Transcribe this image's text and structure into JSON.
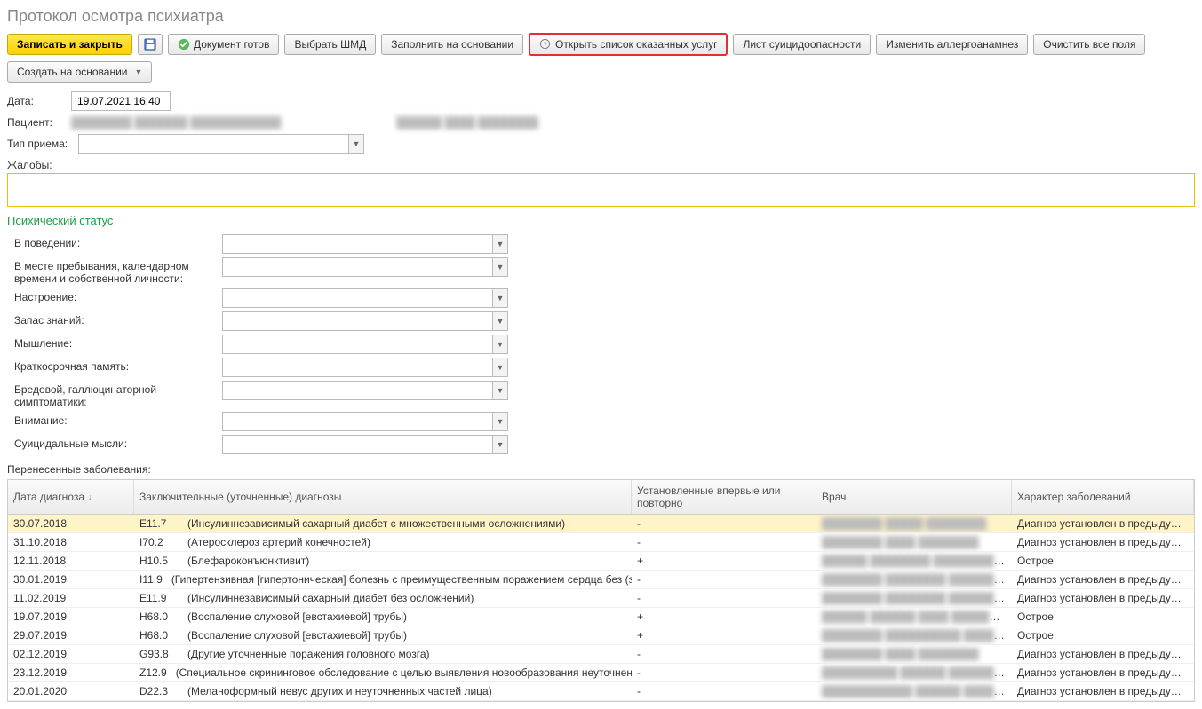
{
  "title": "Протокол осмотра психиатра",
  "toolbar": {
    "save_close": "Записать и закрыть",
    "doc_ready": "Документ готов",
    "select_shmd": "Выбрать ШМД",
    "fill_basis": "Заполнить на основании",
    "open_services": "Открыть список оказанных услуг",
    "suicide_sheet": "Лист суицидоопасности",
    "change_allergo": "Изменить аллергоанамнез",
    "clear_all": "Очистить все поля",
    "create_basis": "Создать на основании"
  },
  "form": {
    "date_label": "Дата:",
    "date_value": "19.07.2021 16:40",
    "patient_label": "Пациент:",
    "patient_value": "████████ ███████ ████████████",
    "patient_extra": "██████ ████ ████████",
    "type_label": "Тип приема:",
    "type_value": "",
    "complaints_label": "Жалобы:",
    "complaints_value": ""
  },
  "psych_status": {
    "title": "Психический статус",
    "rows": [
      {
        "label": "В поведении:",
        "value": ""
      },
      {
        "label": "В месте пребывания, календарном времени и собственной личности:",
        "value": ""
      },
      {
        "label": "Настроение:",
        "value": ""
      },
      {
        "label": "Запас знаний:",
        "value": ""
      },
      {
        "label": "Мышление:",
        "value": ""
      },
      {
        "label": "Краткосрочная память:",
        "value": ""
      },
      {
        "label": "Бредовой, галлюцинаторной симптоматики:",
        "value": ""
      },
      {
        "label": "Внимание:",
        "value": ""
      },
      {
        "label": "Суицидальные мысли:",
        "value": ""
      }
    ]
  },
  "diseases": {
    "label": "Перенесенные заболевания:",
    "columns": {
      "date": "Дата диагноза",
      "diag": "Заключительные (уточненные) диагнозы",
      "ust": "Установленные впервые или повторно",
      "doc": "Врач",
      "char": "Характер заболеваний"
    },
    "rows": [
      {
        "date": "30.07.2018",
        "code": "E11.7",
        "name": "(Инсулиннезависимый сахарный диабет с множественными осложнениями)",
        "ust": "-",
        "doc": "████████ █████ ████████",
        "char": "Диагноз установлен в предыдущем го…",
        "sel": true
      },
      {
        "date": "31.10.2018",
        "code": "I70.2",
        "name": "(Атеросклероз артерий конечностей)",
        "ust": "-",
        "doc": "████████ ████ ████████",
        "char": "Диагноз установлен в предыдущем го…"
      },
      {
        "date": "12.11.2018",
        "code": "H10.5",
        "name": "(Блефароконъюнктивит)",
        "ust": "+",
        "doc": "██████ ████████ ██████████",
        "char": "Острое"
      },
      {
        "date": "30.01.2019",
        "code": "I11.9",
        "name": "(Гипертензивная [гипертоническая] болезнь с преимущественным поражением сердца без (зас…",
        "ust": "-",
        "doc": "████████ ████████ ██████████████",
        "char": "Диагноз установлен в предыдущем го…"
      },
      {
        "date": "11.02.2019",
        "code": "E11.9",
        "name": "(Инсулиннезависимый сахарный диабет без осложнений)",
        "ust": "-",
        "doc": "████████ ████████ ██████████",
        "char": "Диагноз установлен в предыдущем го…"
      },
      {
        "date": "19.07.2019",
        "code": "H68.0",
        "name": "(Воспаление слуховой [евстахиевой] трубы)",
        "ust": "+",
        "doc": "██████ ██████ ████ ██████████",
        "char": "Острое"
      },
      {
        "date": "29.07.2019",
        "code": "H68.0",
        "name": "(Воспаление слуховой [евстахиевой] трубы)",
        "ust": "+",
        "doc": "████████ ██████████ ██████████",
        "char": "Острое"
      },
      {
        "date": "02.12.2019",
        "code": "G93.8",
        "name": "(Другие уточненные поражения головного мозга)",
        "ust": "-",
        "doc": "████████ ████ ████████",
        "char": "Диагноз установлен в предыдущем го…"
      },
      {
        "date": "23.12.2019",
        "code": "Z12.9",
        "name": "(Специальное скрининговое обследование с целью выявления новообразования неуточненного)",
        "ust": "-",
        "doc": "██████████ ██████ ██████████████",
        "char": "Диагноз установлен в предыдущем го…"
      },
      {
        "date": "20.01.2020",
        "code": "D22.3",
        "name": "(Меланоформный невус других и неуточненных частей лица)",
        "ust": "-",
        "doc": "████████████ ██████ ██████████",
        "char": "Диагноз установлен в предыдущем го…"
      }
    ]
  }
}
